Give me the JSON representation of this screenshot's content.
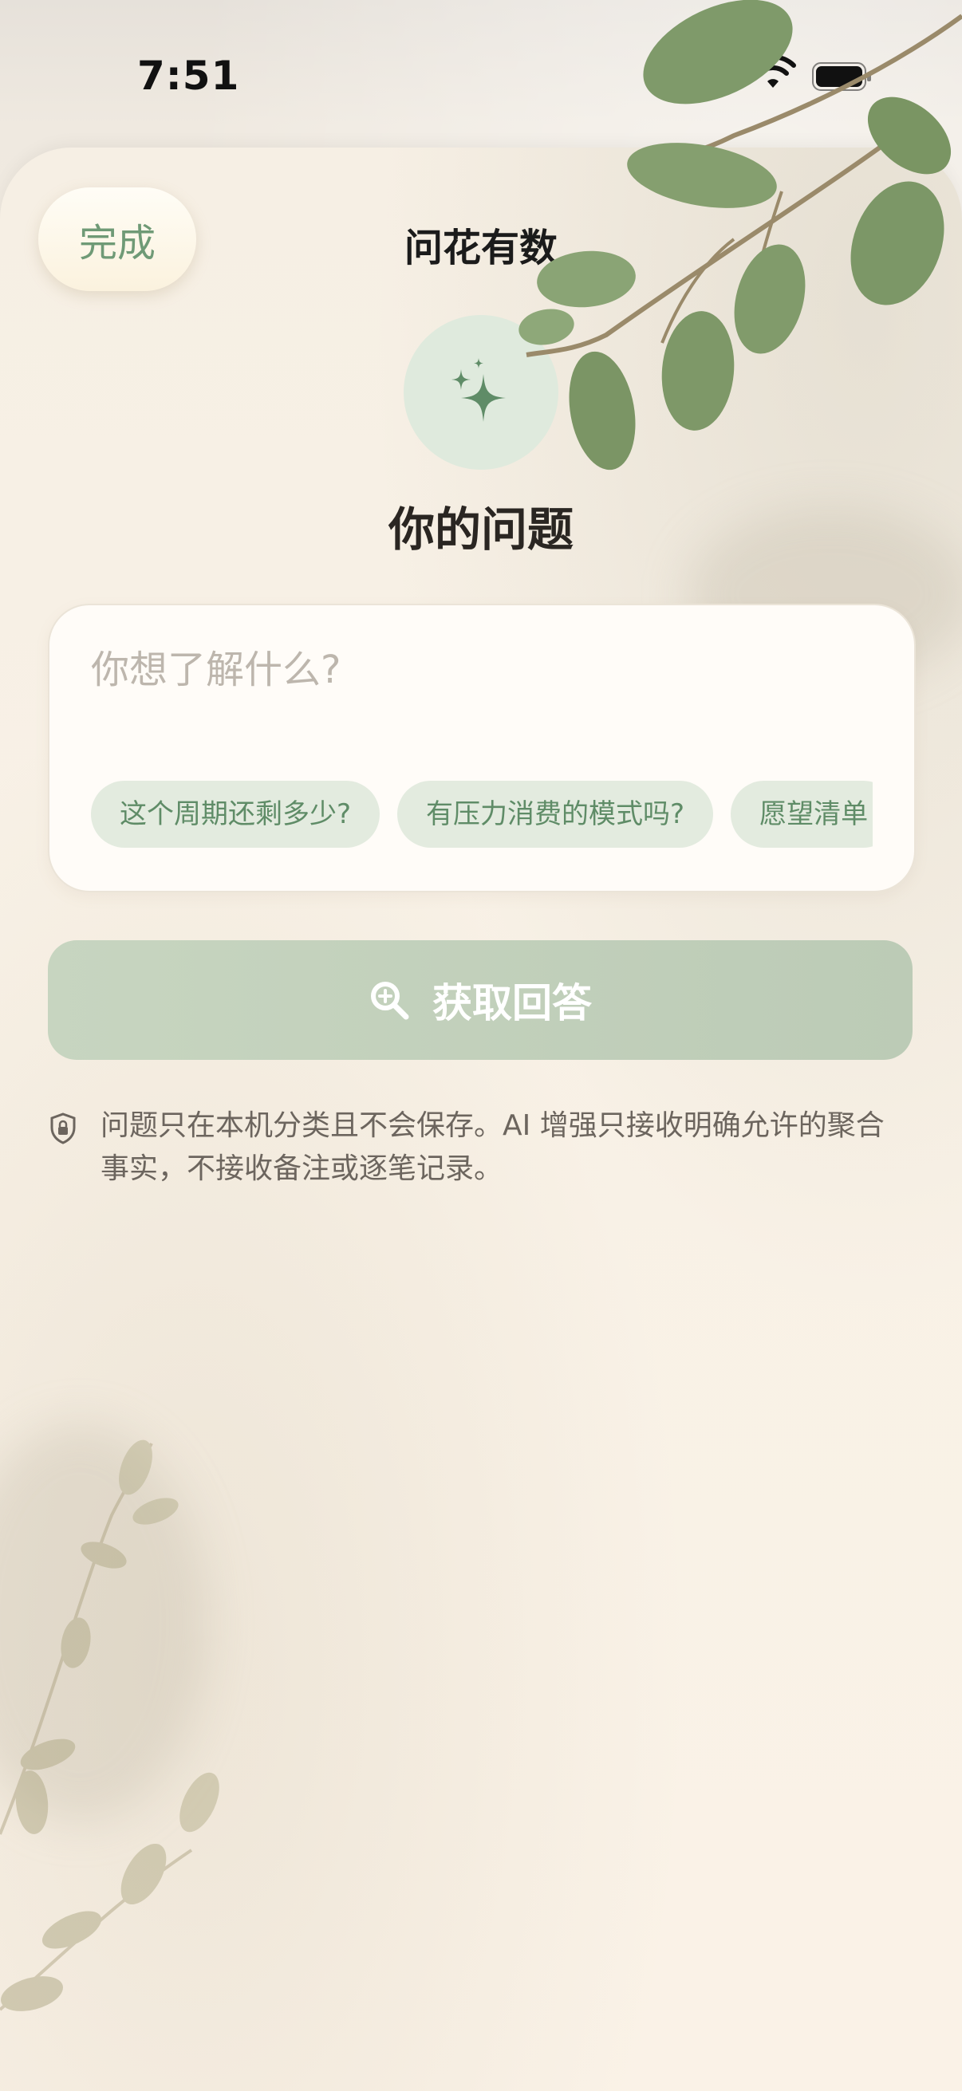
{
  "status_bar": {
    "time": "7:51"
  },
  "nav": {
    "done_label": "完成",
    "title": "问花有数"
  },
  "main": {
    "section_title": "你的问题",
    "question_input": {
      "value": "",
      "placeholder": "你想了解什么?"
    },
    "suggestions": [
      "这个周期还剩多少?",
      "有压力消费的模式吗?",
      "愿望清单"
    ],
    "submit_label": "获取回答",
    "privacy_note": "问题只在本机分类且不会保存。AI 增强只接收明确允许的聚合事实，不接收备注或逐笔记录。"
  },
  "colors": {
    "accent_green": "#6f9a76",
    "chip_bg": "#e3ebdf",
    "button_bg": "#c2d1bb",
    "sheet_bg": "#f8f1e6"
  },
  "icons": [
    "wifi-icon",
    "battery-icon",
    "sparkles-icon",
    "search-icon",
    "shield-icon"
  ]
}
